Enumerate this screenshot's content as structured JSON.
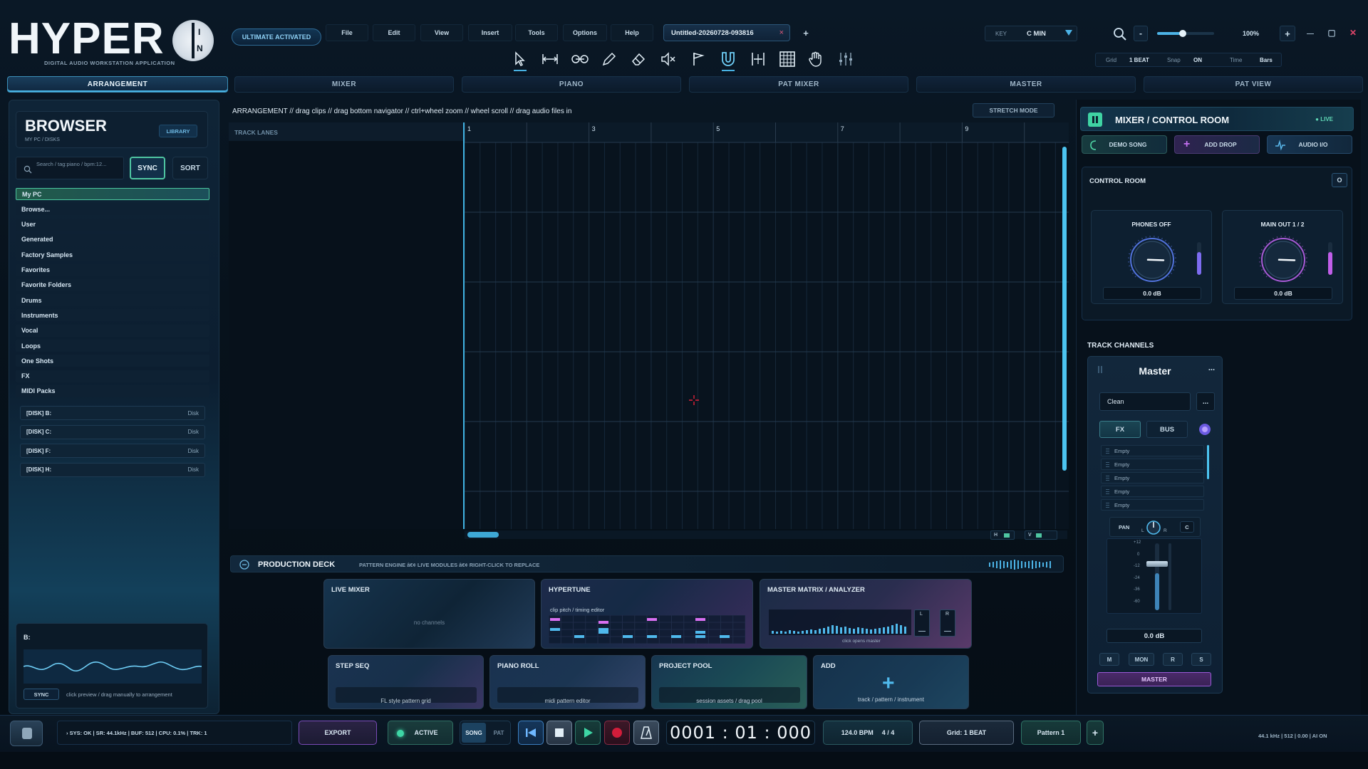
{
  "app": {
    "logo_text": "HYPER",
    "logo_suffix_top": "I",
    "logo_suffix_bottom": "N",
    "subtitle": "DIGITAL AUDIO WORKSTATION APPLICATION",
    "badge": "ULTIMATE ACTIVATED"
  },
  "menu": [
    "File",
    "Edit",
    "View",
    "Insert",
    "Tools",
    "Options",
    "Help"
  ],
  "project_tab": {
    "name": "Untitled-20260728-093816",
    "close": "×",
    "add": "+"
  },
  "key": {
    "label": "KEY",
    "value": "C MIN"
  },
  "zoom": {
    "minus": "-",
    "plus": "+",
    "value": "100%",
    "level": 0.45
  },
  "window": {
    "minimize": "—",
    "maximize": "▢",
    "close": "✕"
  },
  "grid_settings": {
    "grid_label": "Grid",
    "grid_value": "1 BEAT",
    "snap_label": "Snap",
    "snap_value": "ON",
    "time_label": "Time",
    "time_value": "Bars"
  },
  "tools": [
    "pointer-tool",
    "stretch-tool",
    "slice-tool",
    "pencil-tool",
    "eraser-tool",
    "mute-tool",
    "marker-tool",
    "magnet-tool",
    "split-tool",
    "grid-tool",
    "hand-tool",
    "mixer-tool"
  ],
  "tabs": [
    "ARRANGEMENT",
    "MIXER",
    "PIANO",
    "PAT MIXER",
    "MASTER",
    "PAT VIEW"
  ],
  "browser": {
    "title": "BROWSER",
    "path": "MY PC / DISKS",
    "library": "LIBRARY",
    "search_placeholder": "Search / tag:piano / bpm:12...",
    "sync": "SYNC",
    "sort": "SORT",
    "items": [
      "My PC",
      "Browse...",
      "User",
      "Generated",
      "Factory Samples",
      "Favorites",
      "Favorite Folders",
      "Drums",
      "Instruments",
      "Vocal",
      "Loops",
      "One Shots",
      "FX",
      "MIDI Packs"
    ],
    "disks": [
      {
        "name": "[DISK] B:",
        "type": "Disk"
      },
      {
        "name": "[DISK] C:",
        "type": "Disk"
      },
      {
        "name": "[DISK] F:",
        "type": "Disk"
      },
      {
        "name": "[DISK] H:",
        "type": "Disk"
      }
    ],
    "preview_label": "B:",
    "preview_sync": "SYNC",
    "preview_hint": "click preview / drag manually to arrangement"
  },
  "arrangement": {
    "hint": "ARRANGEMENT // drag clips // drag bottom navigator // ctrl+wheel zoom // wheel scroll // drag audio files in",
    "stretch_mode": "STRETCH MODE",
    "track_lanes": "TRACK LANES",
    "bar_numbers": [
      "1",
      "3",
      "5",
      "7",
      "9"
    ],
    "h_label": "H",
    "v_label": "V"
  },
  "deck": {
    "title": "PRODUCTION DECK",
    "meta": "PATTERN ENGINE  â€¢  LIVE MODULES  â€¢  RIGHT-CLICK TO REPLACE",
    "cards": {
      "live_mixer": {
        "title": "LIVE MIXER",
        "sub": "no channels"
      },
      "hypertune": {
        "title": "HYPERTUNE",
        "sub": "clip pitch / timing editor"
      },
      "master_matrix": {
        "title": "MASTER MATRIX / ANALYZER",
        "sub": "click opens master",
        "l": "L",
        "r": "R"
      },
      "step_seq": {
        "title": "STEP SEQ",
        "sub": "FL style pattern grid"
      },
      "piano_roll": {
        "title": "PIANO ROLL",
        "sub": "midi pattern editor"
      },
      "project_pool": {
        "title": "PROJECT POOL",
        "sub": "session assets / drag pool"
      },
      "add": {
        "title": "ADD",
        "plus": "+",
        "sub": "track / pattern / instrument"
      }
    }
  },
  "mixer": {
    "title": "MIXER / CONTROL ROOM",
    "live": "● LIVE",
    "demo_song": "DEMO SONG",
    "add_drop": "ADD DROP",
    "audio_io": "AUDIO I/O",
    "control_room": "CONTROL ROOM",
    "cr_btn": "O",
    "knobs": [
      {
        "label": "PHONES OFF",
        "value": "0.0 dB",
        "level": 0.5
      },
      {
        "label": "MAIN OUT 1 / 2",
        "value": "0.0 dB",
        "level": 0.75
      }
    ],
    "track_channels": "TRACK CHANNELS",
    "channel": {
      "name": "Master",
      "menu": "...",
      "preset": "Clean",
      "preset_menu": "...",
      "fx": "FX",
      "bus": "BUS",
      "slots": [
        "Empty",
        "Empty",
        "Empty",
        "Empty",
        "Empty"
      ],
      "pan": "PAN",
      "pan_l": "L",
      "pan_r": "R",
      "pan_c": "C",
      "fader_scale": [
        "+12",
        "0",
        "-12",
        "-24",
        "-36",
        "-60"
      ],
      "gain": "0.0 dB",
      "buttons": [
        "M",
        "MON",
        "R",
        "S"
      ],
      "output": "MASTER"
    }
  },
  "transport": {
    "status": "› SYS: OK | SR: 44.1kHz | BUF: 512 | CPU: 0.1% | TRK: 1",
    "export": "EXPORT",
    "active": "ACTIVE",
    "song": "SONG",
    "pat": "PAT",
    "time": "0001 : 01 : 000",
    "bpm": "124.0 BPM",
    "sig": "4 / 4",
    "grid": "Grid: 1 BEAT",
    "pattern": "Pattern 1",
    "add": "+",
    "right_info": "44.1 kHz | 512 | 0.00 | AI ON"
  },
  "colors": {
    "accent": "#48b2e3",
    "green": "#4cc7a0",
    "purple": "#b06be0",
    "record": "#d11d3a"
  }
}
